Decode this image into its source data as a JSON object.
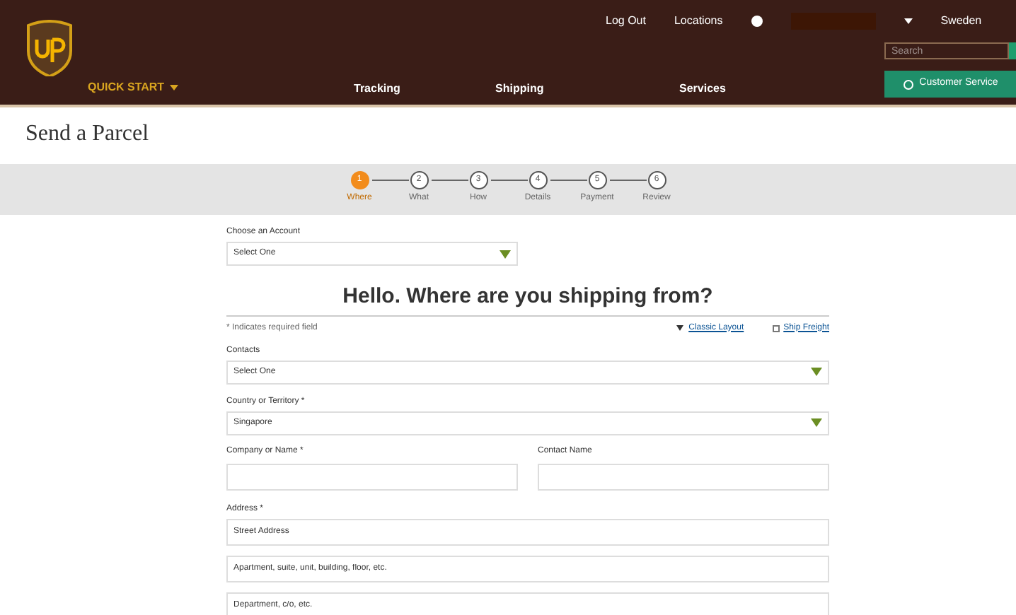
{
  "header": {
    "top_links": [
      "Log Out",
      "Locations"
    ],
    "region": "Sweden",
    "search": {
      "placeholder": "Search"
    },
    "quick_start": "QUICK START",
    "nav": [
      "Tracking",
      "Shipping",
      "Services"
    ],
    "service_button": "Customer Service"
  },
  "page_title": "Send a Parcel",
  "steps": [
    {
      "number": "1",
      "label": "Where",
      "selected": true
    },
    {
      "number": "2",
      "label": "What",
      "selected": false
    },
    {
      "number": "3",
      "label": "How",
      "selected": false
    },
    {
      "number": "4",
      "label": "Details",
      "selected": false
    },
    {
      "number": "5",
      "label": "Payment",
      "selected": false
    },
    {
      "number": "6",
      "label": "Review",
      "selected": false
    }
  ],
  "account": {
    "label": "Choose an Account",
    "value": "Select One"
  },
  "heading": "Hello. Where are you shipping from?",
  "required_note": "* Indicates required field",
  "classic_layout": "Classic Layout",
  "ship_freight": {
    "label": "Ship Freight",
    "checked": false
  },
  "contacts": {
    "label": "Contacts",
    "value": "Select One"
  },
  "country": {
    "label": "Country or Territory *",
    "value": "Singapore"
  },
  "company": {
    "label": "Company or Name *"
  },
  "contact_name": {
    "label": "Contact Name"
  },
  "address": {
    "label": "Address *",
    "placeholders": [
      "Street Address",
      "Apartment, suite, unit, building, floor, etc.",
      "Department, c/o, etc."
    ]
  }
}
